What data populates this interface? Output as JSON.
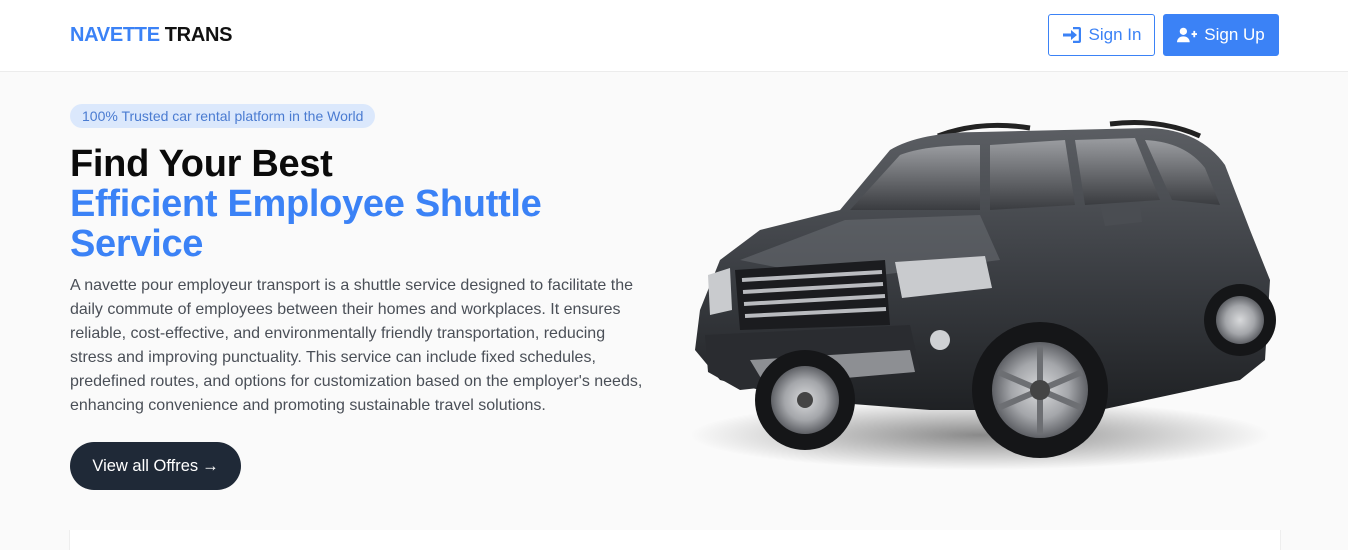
{
  "header": {
    "brand_part1": "NAVETTE",
    "brand_part2": "TRANS",
    "signin_label": "Sign In",
    "signup_label": "Sign Up",
    "signin_icon": "sign-in-icon",
    "signup_icon": "user-plus-icon"
  },
  "hero": {
    "badge": "100% Trusted car rental platform in the World",
    "title_line1": "Find Your Best",
    "title_accent": "Efficient Employee Shuttle Service",
    "description": "A navette pour employeur transport is a shuttle service designed to facilitate the daily commute of employees between their homes and workplaces. It ensures reliable, cost-effective, and environmentally friendly transportation, reducing stress and improving punctuality. This service can include fixed schedules, predefined routes, and options for customization based on the employer's needs, enhancing convenience and promoting sustainable travel solutions.",
    "cta_label": "View all Offres",
    "cta_arrow": "→"
  },
  "colors": {
    "accent": "#3b82f6",
    "dark": "#1f2937",
    "badge_bg": "#dbe8fc"
  }
}
